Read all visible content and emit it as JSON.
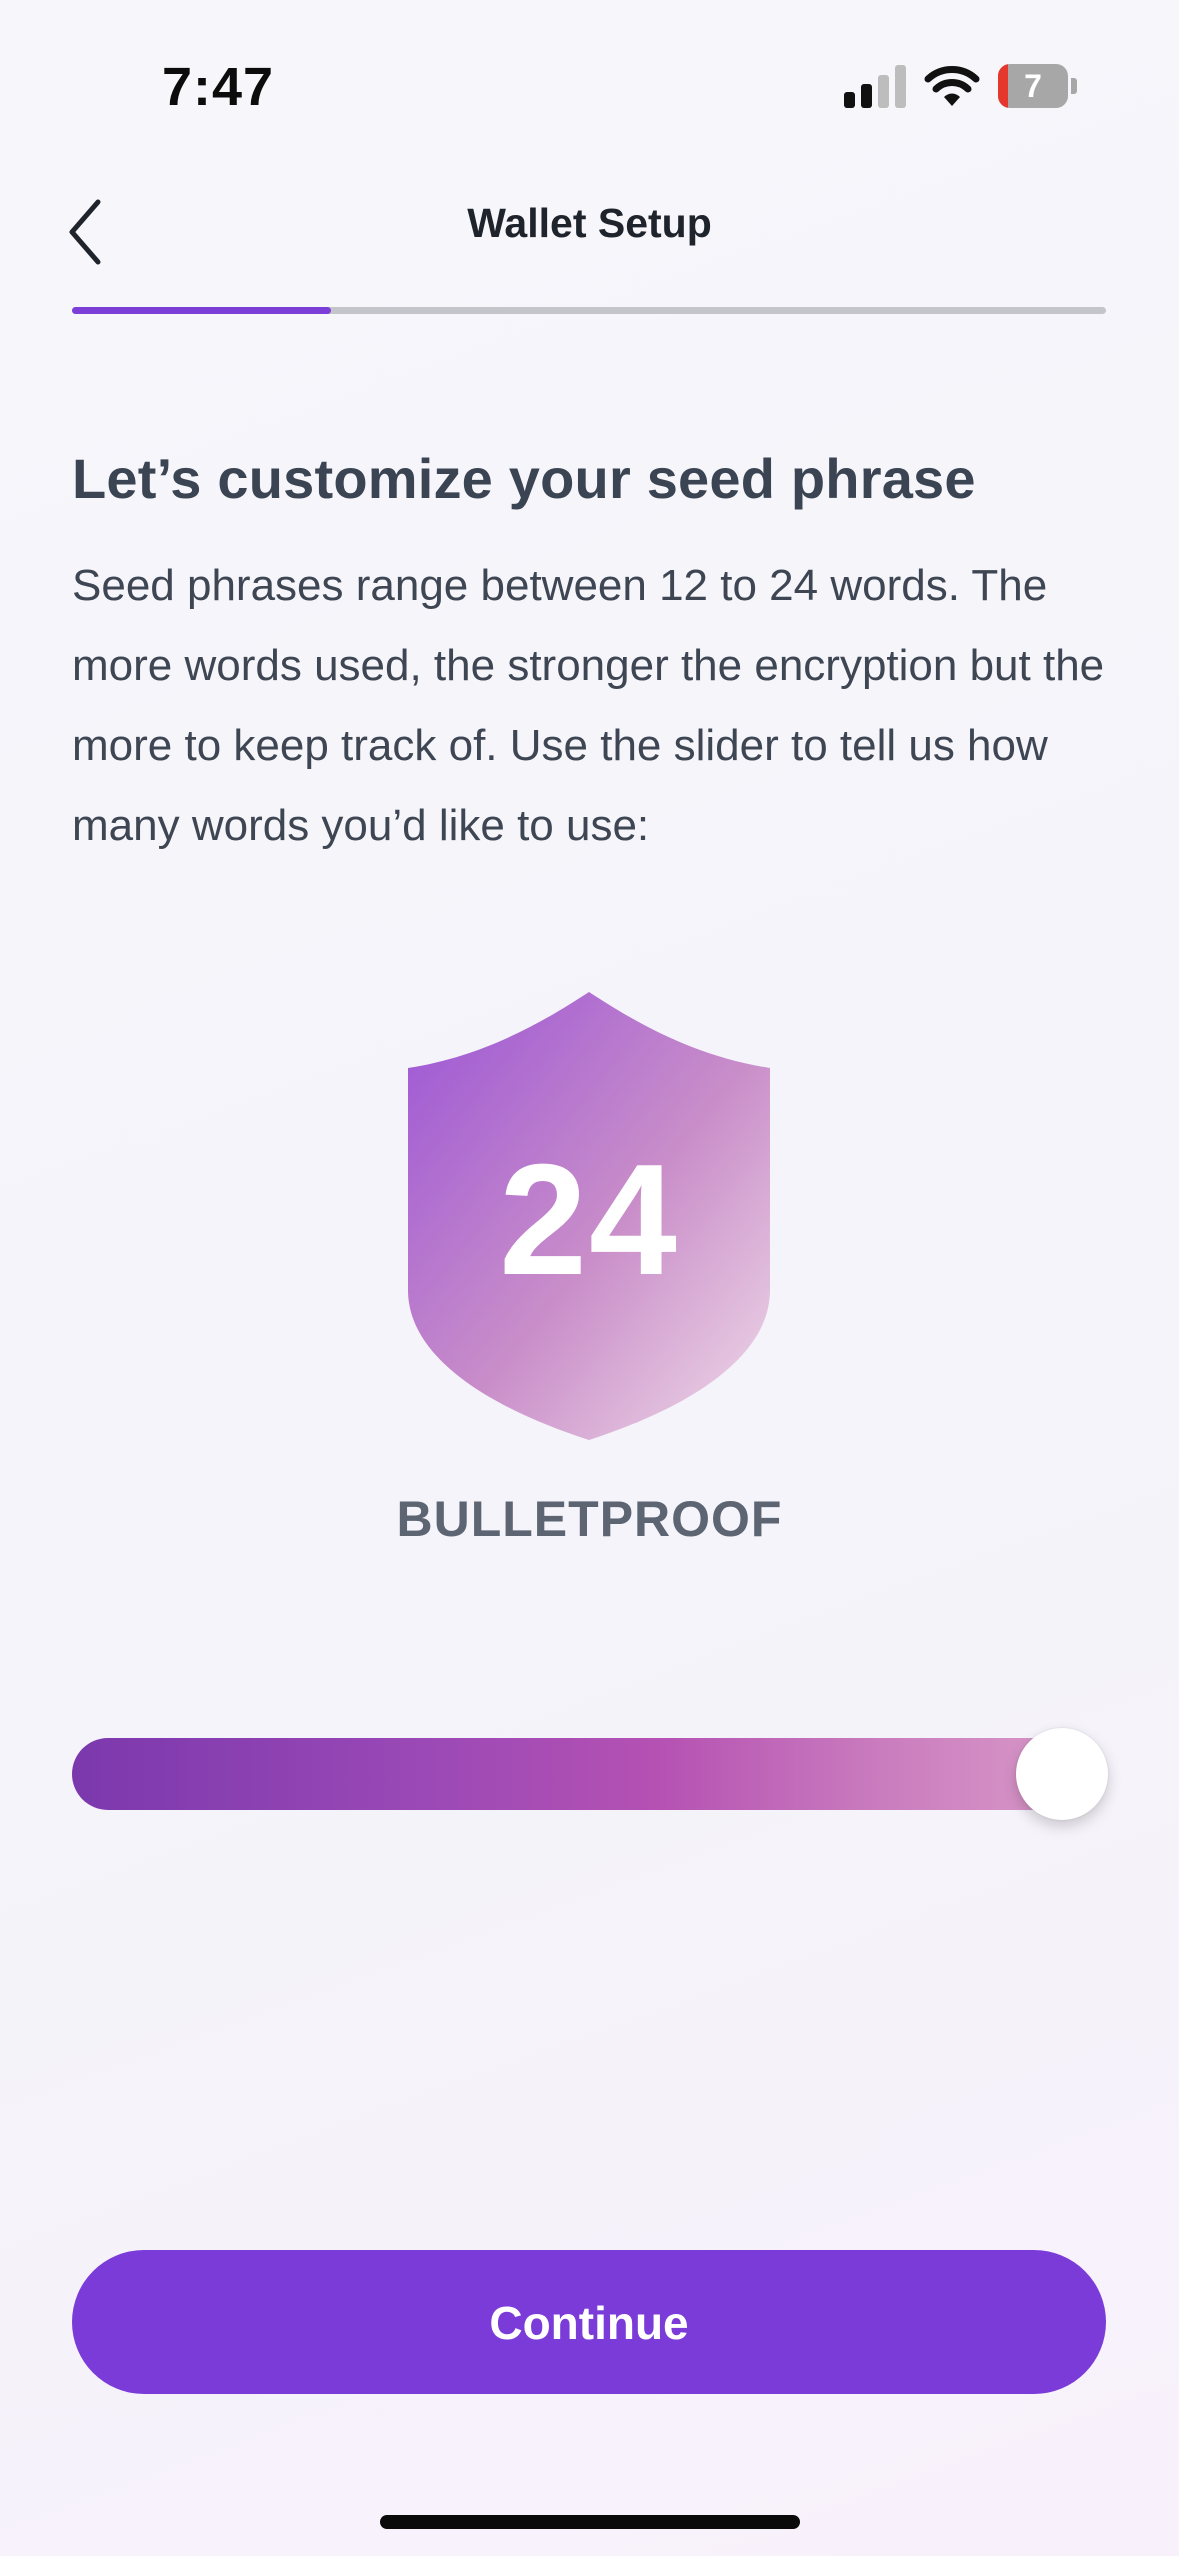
{
  "status_bar": {
    "time": "7:47",
    "battery_level": "7",
    "signal_bars_active": 2,
    "signal_bars_total": 4,
    "icons": [
      "signal-icon",
      "wifi-icon",
      "battery-icon"
    ]
  },
  "header": {
    "back_icon": "chevron-left-icon",
    "title": "Wallet Setup"
  },
  "progress": {
    "fraction": 0.25,
    "color": "#7b3fd8"
  },
  "content": {
    "headline": "Let’s customize your seed phrase",
    "description": "Seed phrases range between 12 to 24 words. The more words used, the stronger the encryption but the more to keep track of. Use the slider to tell us how many words you’d like to use:"
  },
  "shield": {
    "icon": "shield-icon",
    "word_count": "24",
    "strength_label": "BULLETPROOF"
  },
  "slider": {
    "min": 12,
    "max": 24,
    "value": 24
  },
  "actions": {
    "continue_label": "Continue"
  },
  "colors": {
    "accent": "#7a3bd9",
    "heading": "#3b4452",
    "shield_gradient_start": "#9d5ad6",
    "shield_gradient_end": "#ecd0e6"
  }
}
